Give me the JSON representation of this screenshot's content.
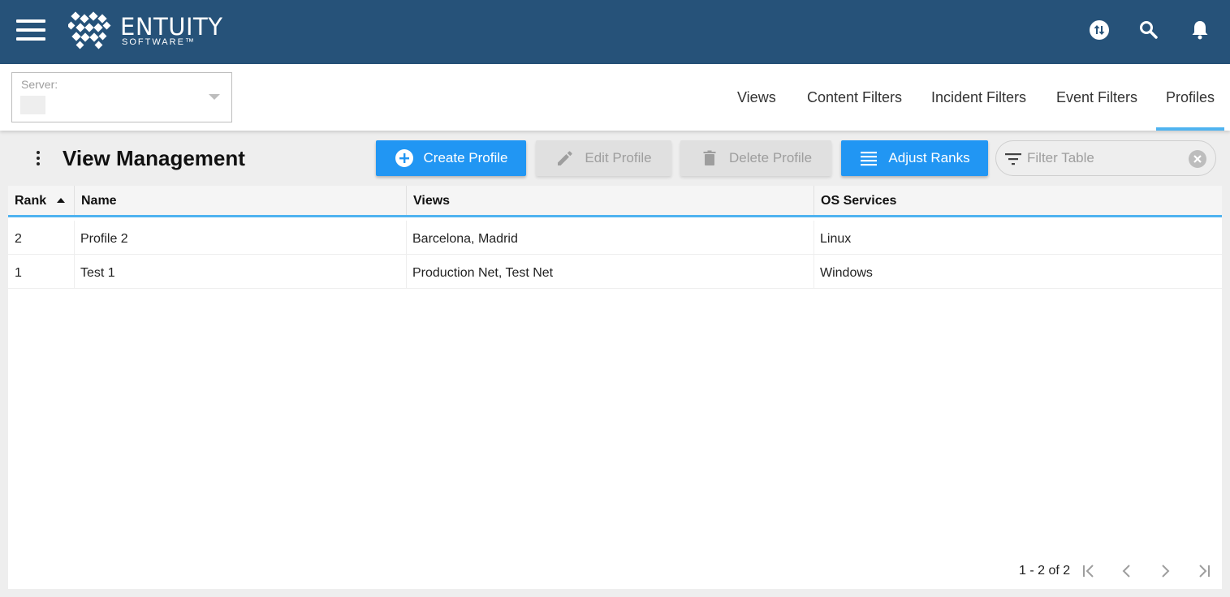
{
  "brand": {
    "name": "ENTUITY",
    "sub": "SOFTWARE™"
  },
  "header_icons": [
    "sync-icon",
    "search-icon",
    "notifications-icon"
  ],
  "server": {
    "label": "Server:",
    "value": ""
  },
  "nav_tabs": [
    {
      "label": "Views",
      "active": false
    },
    {
      "label": "Content Filters",
      "active": false
    },
    {
      "label": "Incident Filters",
      "active": false
    },
    {
      "label": "Event Filters",
      "active": false
    },
    {
      "label": "Profiles",
      "active": true
    }
  ],
  "page": {
    "title": "View Management"
  },
  "toolbar": {
    "create_label": "Create Profile",
    "edit_label": "Edit Profile",
    "delete_label": "Delete Profile",
    "adjust_label": "Adjust Ranks",
    "filter_placeholder": "Filter Table"
  },
  "table": {
    "columns": [
      "Rank",
      "Name",
      "Views",
      "OS Services"
    ],
    "sort": {
      "column": "Rank",
      "direction": "ascending"
    },
    "rows": [
      {
        "rank": "2",
        "name": "Profile 2",
        "views": "Barcelona, Madrid",
        "os_services": "Linux"
      },
      {
        "rank": "1",
        "name": "Test 1",
        "views": "Production Net, Test Net",
        "os_services": "Windows"
      }
    ]
  },
  "pagination": {
    "summary": "1 - 2 of 2"
  },
  "colors": {
    "header_bg": "#265279",
    "primary": "#2196f3",
    "accent_underline": "#4fb3f0"
  }
}
